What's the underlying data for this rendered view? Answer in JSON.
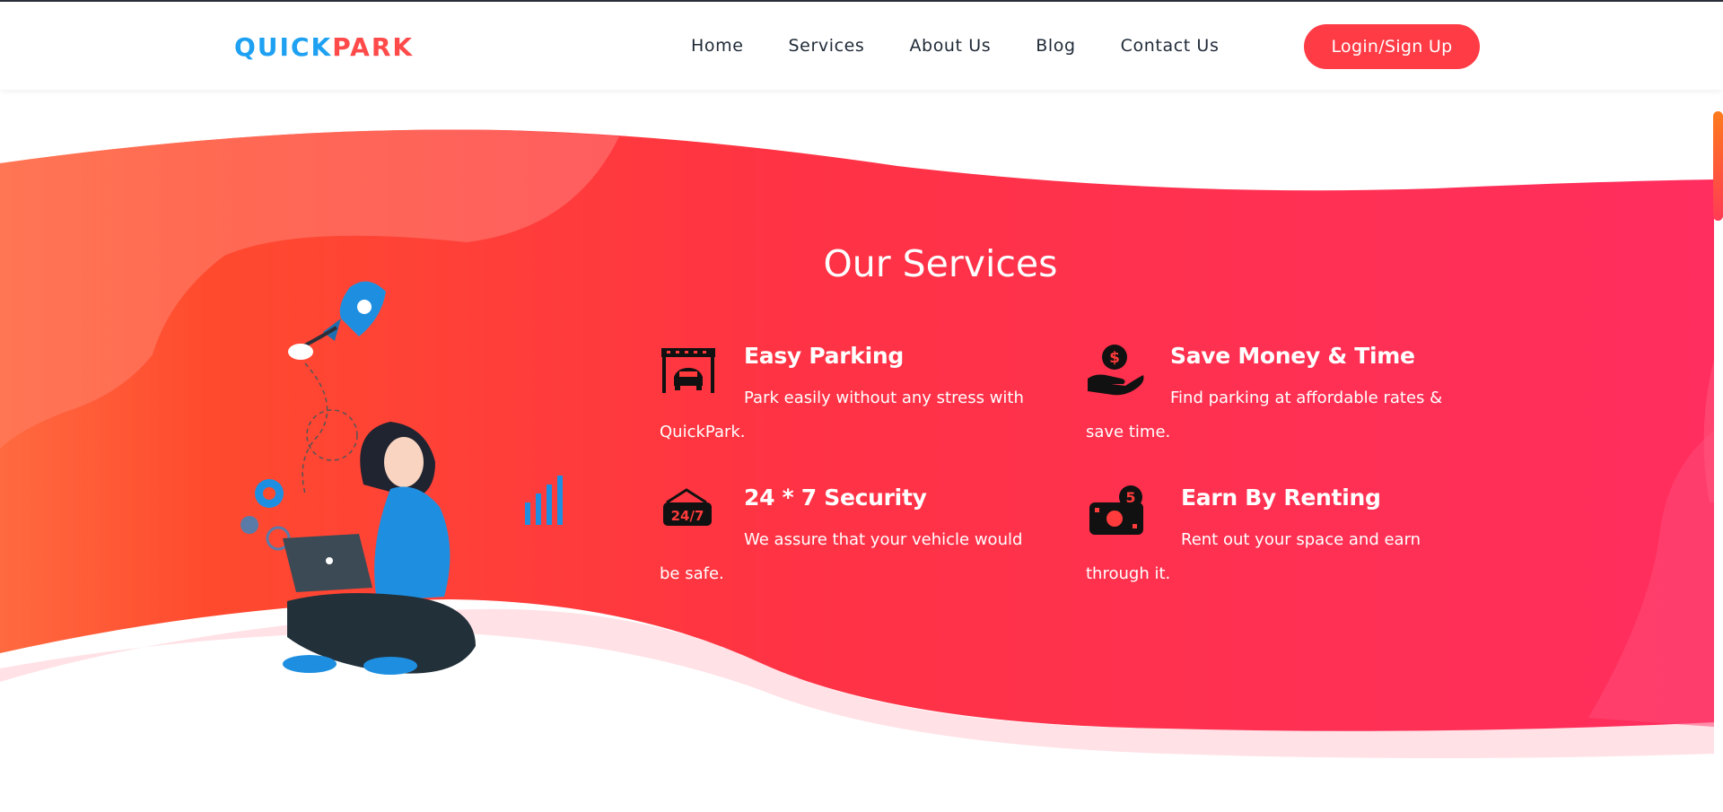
{
  "brand": {
    "part1": "QUICK",
    "part2": "PARK"
  },
  "nav": [
    {
      "label": "Home"
    },
    {
      "label": "Services"
    },
    {
      "label": "About Us"
    },
    {
      "label": "Blog"
    },
    {
      "label": "Contact Us"
    }
  ],
  "login_label": "Login/Sign Up",
  "section_title": "Our Services",
  "services": [
    {
      "title": "Easy Parking",
      "text": "Park easily without any stress with QuickPark.",
      "icon": "garage-car-icon"
    },
    {
      "title": "Save Money & Time",
      "text": "Find parking at affordable rates & save time.",
      "icon": "hand-money-icon"
    },
    {
      "title": "24 * 7 Security",
      "text": "We assure that your vehicle would be safe.",
      "icon": "24-7-sign-icon"
    },
    {
      "title": "Earn By Renting",
      "text": "Rent out your space and earn through it.",
      "icon": "cash-bill-icon"
    }
  ],
  "colors": {
    "brand_blue": "#1ea1f2",
    "brand_red": "#ff4a4a",
    "accent": "#ff3c46",
    "wave_start": "#ff5a3a",
    "wave_end": "#ff2e5e"
  }
}
